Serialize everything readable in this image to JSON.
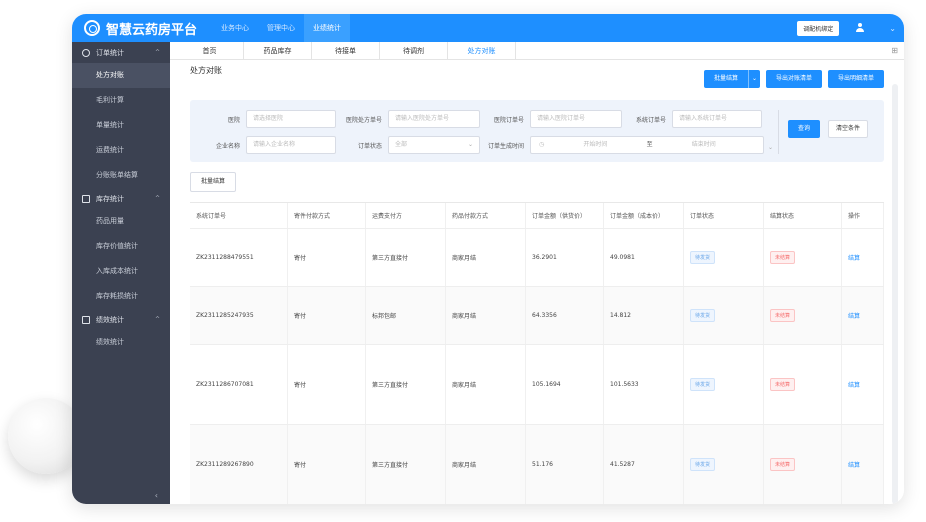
{
  "app": {
    "title": "智慧云药房平台"
  },
  "topnav": [
    "业务中心",
    "管理中心",
    "业绩统计"
  ],
  "topbar": {
    "bind_button": "调配机绑定"
  },
  "sidebar": {
    "groups": [
      {
        "label": "订单统计",
        "items": [
          "处方对账",
          "毛利计算",
          "单量统计",
          "运费统计",
          "分账账单结算"
        ]
      },
      {
        "label": "库存统计",
        "items": [
          "药品用量",
          "库存价值统计",
          "入库成本统计",
          "库存耗损统计"
        ]
      },
      {
        "label": "绩效统计",
        "items": [
          "绩效统计"
        ]
      }
    ]
  },
  "tabs": [
    "首页",
    "药品库存",
    "待接单",
    "待调剂",
    "处方对账"
  ],
  "page": {
    "title": "处方对账"
  },
  "actions": {
    "batch_settle": "批量结算",
    "export_reconcile": "导出对账清单",
    "export_detail": "导出明细清单"
  },
  "filters": {
    "hospital_label": "医院",
    "hospital_placeholder": "请选择医院",
    "hosp_rx_label": "医院处方单号",
    "hosp_rx_placeholder": "请输入医院处方单号",
    "hosp_order_label": "医院订单号",
    "hosp_order_placeholder": "请输入医院订单号",
    "sys_order_label": "系统订单号",
    "sys_order_placeholder": "请输入系统订单号",
    "company_label": "企业名称",
    "company_placeholder": "请输入企业名称",
    "status_label": "订单状态",
    "status_value": "全部",
    "time_label": "订单生成时间",
    "start_placeholder": "开始时间",
    "to": "至",
    "end_placeholder": "结束时间",
    "query": "查询",
    "clear": "清空条件"
  },
  "batch_button": "批量结算",
  "table": {
    "headers": [
      "系统订单号",
      "寄件付款方式",
      "运费支付方",
      "药品付款方式",
      "订单金额（供货价）",
      "订单金额（成本价）",
      "订单状态",
      "结算状态",
      "操作"
    ],
    "rows": [
      {
        "order": "ZK2311288479551",
        "pay": "寄付",
        "freight": "第三方直接付",
        "drug_pay": "商家月结",
        "supply": "36.2901",
        "cost": "49.0981",
        "status": "待发货",
        "settle": "未结算",
        "op": "结算"
      },
      {
        "order": "ZK2311285247935",
        "pay": "寄付",
        "freight": "标邦包邮",
        "drug_pay": "商家月结",
        "supply": "64.3356",
        "cost": "14.812",
        "status": "待发货",
        "settle": "未结算",
        "op": "结算"
      },
      {
        "order": "ZK2311286707081",
        "pay": "寄付",
        "freight": "第三方直接付",
        "drug_pay": "商家月结",
        "supply": "105.1694",
        "cost": "101.5633",
        "status": "待发货",
        "settle": "未结算",
        "op": "结算"
      },
      {
        "order": "ZK2311289267890",
        "pay": "寄付",
        "freight": "第三方直接付",
        "drug_pay": "商家月结",
        "supply": "51.176",
        "cost": "41.5287",
        "status": "待发货",
        "settle": "未结算",
        "op": "结算"
      }
    ]
  },
  "colors": {
    "primary": "#1e8fff",
    "sidebar": "#3b4151",
    "danger": "#f56c6c"
  }
}
